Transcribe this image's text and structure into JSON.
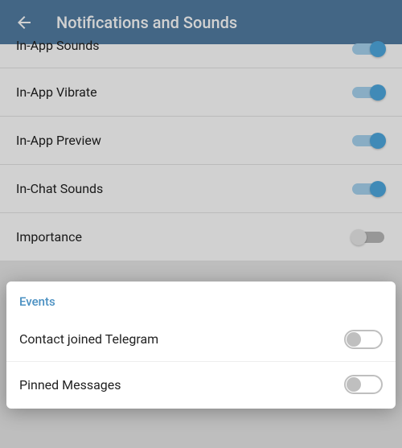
{
  "header": {
    "title": "Notifications and Sounds"
  },
  "bg_settings": [
    {
      "label": "In-App Sounds",
      "on": true
    },
    {
      "label": "In-App Vibrate",
      "on": true
    },
    {
      "label": "In-App Preview",
      "on": true
    },
    {
      "label": "In-Chat Sounds",
      "on": true
    },
    {
      "label": "Importance",
      "on": false
    }
  ],
  "events": {
    "title": "Events",
    "items": [
      {
        "label": "Contact joined Telegram",
        "on": false
      },
      {
        "label": "Pinned Messages",
        "on": false
      }
    ]
  }
}
